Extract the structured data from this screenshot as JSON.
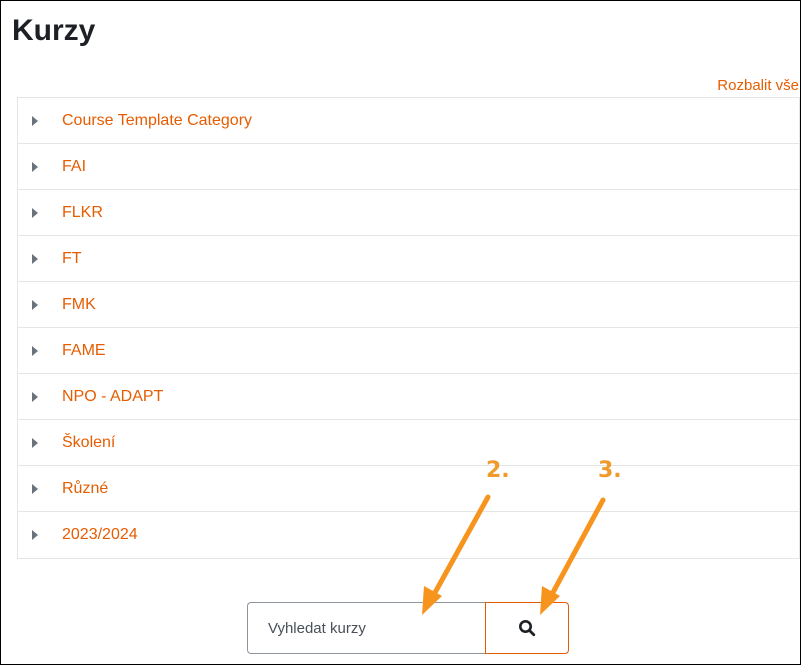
{
  "page": {
    "title": "Kurzy",
    "expand_all_label": "Rozbalit vše"
  },
  "categories": [
    {
      "label": "Course Template Category"
    },
    {
      "label": "FAI"
    },
    {
      "label": "FLKR"
    },
    {
      "label": "FT"
    },
    {
      "label": "FMK"
    },
    {
      "label": "FAME"
    },
    {
      "label": "NPO - ADAPT"
    },
    {
      "label": "Školení"
    },
    {
      "label": "Různé"
    },
    {
      "label": "2023/2024"
    }
  ],
  "search": {
    "placeholder": "Vyhledat kurzy",
    "value": "",
    "button_icon": "search-icon"
  },
  "annotations": [
    {
      "label": "2.",
      "points_to": "search-input"
    },
    {
      "label": "3.",
      "points_to": "search-button"
    }
  ],
  "colors": {
    "accent": "#e65c00",
    "annotation": "#f09a2c",
    "caret": "#6a737b",
    "heading": "#1d2125",
    "border": "#e5e5e5"
  }
}
